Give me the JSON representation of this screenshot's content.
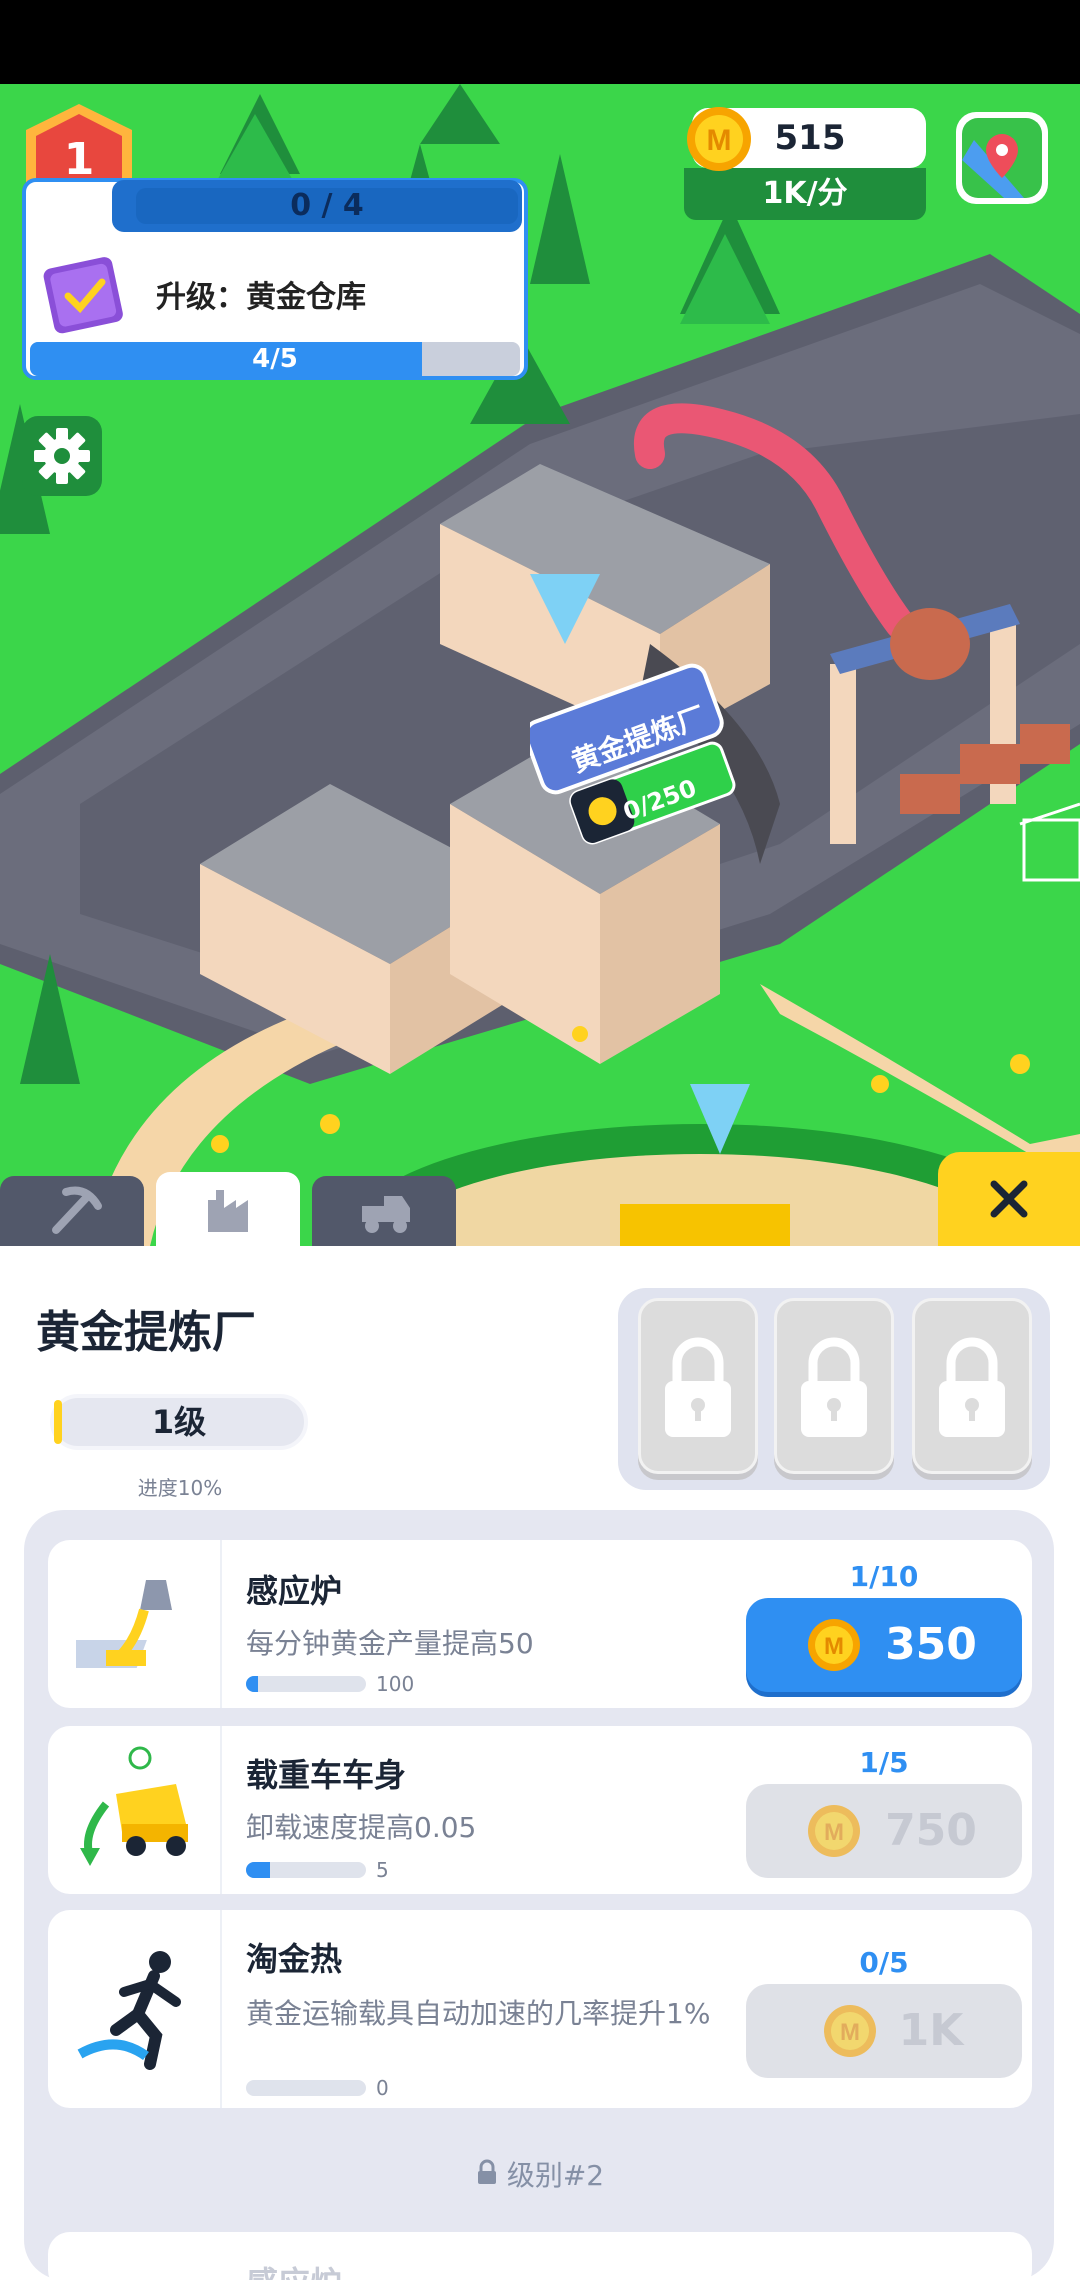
{
  "hud": {
    "player_level": "1",
    "quest_count": "0 / 4",
    "quest_title": "升级：黄金仓库",
    "quest_progress_text": "4/5",
    "quest_progress_fraction": 0.8,
    "coins": "515",
    "coin_rate": "1K/分",
    "coin_symbol": "M"
  },
  "scene": {
    "building_sign": "黄金提炼厂",
    "building_storage": "0/250"
  },
  "tabs": [
    {
      "name": "pickaxe",
      "icon": "pickaxe-icon",
      "active": false
    },
    {
      "name": "factory",
      "icon": "factory-icon",
      "active": true
    },
    {
      "name": "truck",
      "icon": "truck-icon",
      "active": false
    }
  ],
  "panel": {
    "title": "黄金提炼厂",
    "level": "1级",
    "level_fraction": 0.1,
    "progress_label": "进度10%",
    "upgrades": [
      {
        "title": "感应炉",
        "desc": "每分钟黄金产量提高50",
        "count": "1/10",
        "bar_label": "100",
        "bar_fraction": 0.1,
        "price": "350",
        "enabled": true,
        "icon": "furnace-icon"
      },
      {
        "title": "载重车车身",
        "desc": "卸载速度提高0.05",
        "count": "1/5",
        "bar_label": "5",
        "bar_fraction": 0.2,
        "price": "750",
        "enabled": false,
        "icon": "dump-truck-icon"
      },
      {
        "title": "淘金热",
        "desc": "黄金运输载具自动加速的几率提升1%",
        "count": "0/5",
        "bar_label": "0",
        "bar_fraction": 0,
        "price": "1K",
        "enabled": false,
        "icon": "running-man-icon"
      }
    ],
    "locked_level_label": "级别#2",
    "next_upgrade_title": "感应炉"
  },
  "colors": {
    "accent_blue": "#2f8ff2",
    "grass": "#3bd64a",
    "road": "#5d5f6e",
    "gold": "#ffd21f"
  }
}
